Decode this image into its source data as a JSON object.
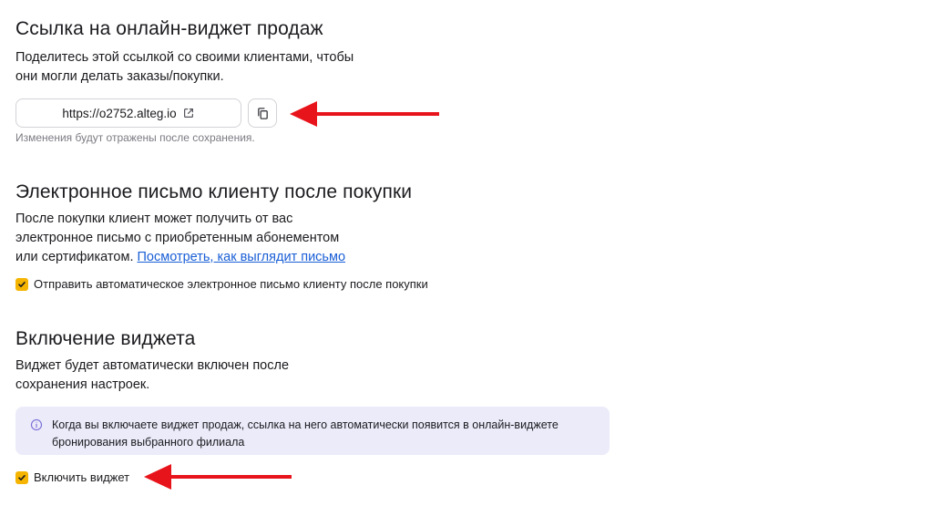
{
  "share_link": {
    "title": "Ссылка на онлайн-виджет продаж",
    "desc_lines": [
      "Поделитесь этой ссылкой со своими клиентами, чтобы",
      "они могли делать заказы/покупки."
    ],
    "url": "https://o2752.alteg.io",
    "hint": "Изменения будут отражены после сохранения."
  },
  "email": {
    "title": "Электронное письмо клиенту после покупки",
    "desc_lines": [
      "После покупки клиент может получить от вас",
      "электронное письмо с приобретенным абонементом"
    ],
    "desc_last_prefix": "или сертификатом. ",
    "preview_link": "Посмотреть, как выглядит письмо",
    "checkbox_label": "Отправить автоматическое электронное письмо клиенту после покупки",
    "checkbox_checked": true
  },
  "enable": {
    "title": "Включение виджета",
    "desc_lines": [
      "Виджет будет автоматически включен после",
      "сохранения настроек."
    ],
    "info_lines": [
      "Когда вы включаете виджет продаж, ссылка на него автоматически появится в онлайн-виджете",
      "бронирования выбранного филиала"
    ],
    "checkbox_label": "Включить виджет",
    "checkbox_checked": true
  },
  "colors": {
    "accent": "#f5b400",
    "link": "#1a5fd6",
    "arrow": "#e8141b",
    "info_bg": "#ebebfa"
  }
}
